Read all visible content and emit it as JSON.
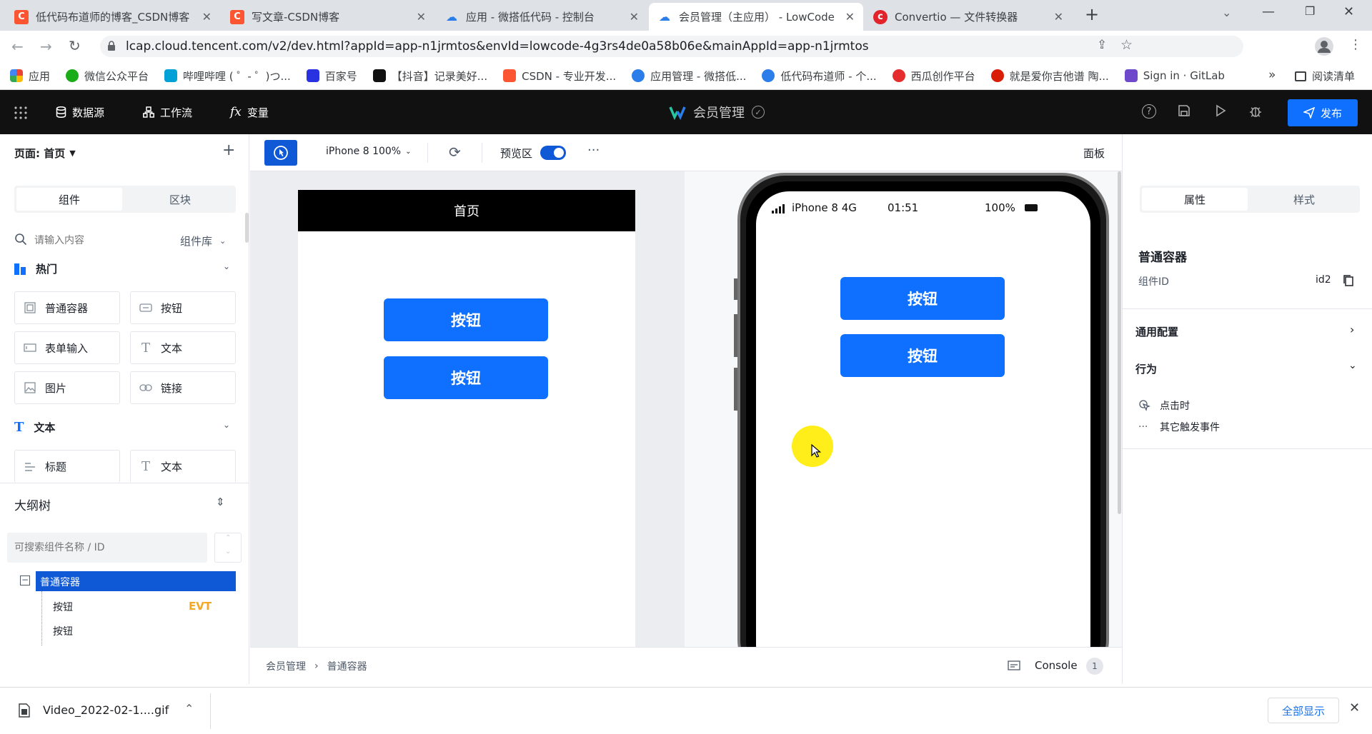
{
  "browser": {
    "tabs": [
      {
        "title": "低代码布道师的博客_CSDN博客",
        "favicon": "csdn",
        "active": false
      },
      {
        "title": "写文章-CSDN博客",
        "favicon": "csdn",
        "active": false
      },
      {
        "title": "应用 - 微搭低代码 - 控制台",
        "favicon": "cloud",
        "active": false
      },
      {
        "title": "会员管理（主应用） - LowCode",
        "favicon": "cloud",
        "active": true
      },
      {
        "title": "Convertio — 文件转换器",
        "favicon": "convertio",
        "active": false
      }
    ],
    "url": "lcap.cloud.tencent.com/v2/dev.html?appId=app-n1jrmtos&envId=lowcode-4g3rs4de0a58b06e&mainAppId=app-n1jrmtos",
    "bookmarks": [
      {
        "label": "应用",
        "color": "#e8453c"
      },
      {
        "label": "微信公众平台",
        "color": "#1aad19"
      },
      {
        "label": "哔哩哔哩 ( ゜- ゜)つ...",
        "color": "#00a1d6"
      },
      {
        "label": "百家号",
        "color": "#2932e1"
      },
      {
        "label": "【抖音】记录美好...",
        "color": "#111111"
      },
      {
        "label": "CSDN - 专业开发...",
        "color": "#fc5531"
      },
      {
        "label": "应用管理 - 微搭低...",
        "color": "#2b7de9"
      },
      {
        "label": "低代码布道师 - 个...",
        "color": "#2b7de9"
      },
      {
        "label": "西瓜创作平台",
        "color": "#e62d2d"
      },
      {
        "label": "就是爱你吉他谱 陶...",
        "color": "#d81e06"
      },
      {
        "label": "Sign in · GitLab",
        "color": "#6e49cb"
      }
    ],
    "more_bookmarks": "»",
    "reading_list": "阅读清单"
  },
  "header": {
    "datasource": "数据源",
    "workflow": "工作流",
    "variable": "变量",
    "app_name": "会员管理",
    "publish": "发布"
  },
  "left_panel": {
    "page_label": "页面: 首页",
    "add": "+",
    "tabs": [
      "组件",
      "区块"
    ],
    "search_placeholder": "请输入内容",
    "library": "组件库",
    "hot_section": "热门",
    "hot_items": [
      "普通容器",
      "按钮",
      "表单输入",
      "文本",
      "图片",
      "链接"
    ],
    "text_section": "文本",
    "text_items": [
      "标题",
      "文本"
    ],
    "outline_title": "大纲树",
    "outline_search": "可搜索组件名称 / ID",
    "tree": {
      "root": "普通容器",
      "children": [
        {
          "label": "按钮",
          "badge": "EVT"
        },
        {
          "label": "按钮",
          "badge": ""
        }
      ]
    }
  },
  "toolbar": {
    "device": "iPhone 8 100%",
    "preview_label": "预览区",
    "more": "···",
    "panel_label": "面板"
  },
  "canvas": {
    "page_title": "首页",
    "buttons": [
      "按钮",
      "按钮"
    ]
  },
  "phone": {
    "carrier": "iPhone 8  4G",
    "time": "01:51",
    "battery": "100%",
    "buttons": [
      "按钮",
      "按钮"
    ]
  },
  "right_panel": {
    "tabs": [
      "属性",
      "样式"
    ],
    "component_name": "普通容器",
    "id_label": "组件ID",
    "id_value": "id2",
    "general": "通用配置",
    "behavior": "行为",
    "on_click": "点击时",
    "other_events": "其它触发事件"
  },
  "breadcrumb": {
    "items": [
      "会员管理",
      "普通容器"
    ],
    "console": "Console",
    "console_count": "1"
  },
  "download": {
    "filename": "Video_2022-02-1....gif",
    "show_all": "全部显示"
  },
  "colors": {
    "accent": "#0f6fff",
    "header_bg": "#111111",
    "badge": "#f5a623"
  }
}
